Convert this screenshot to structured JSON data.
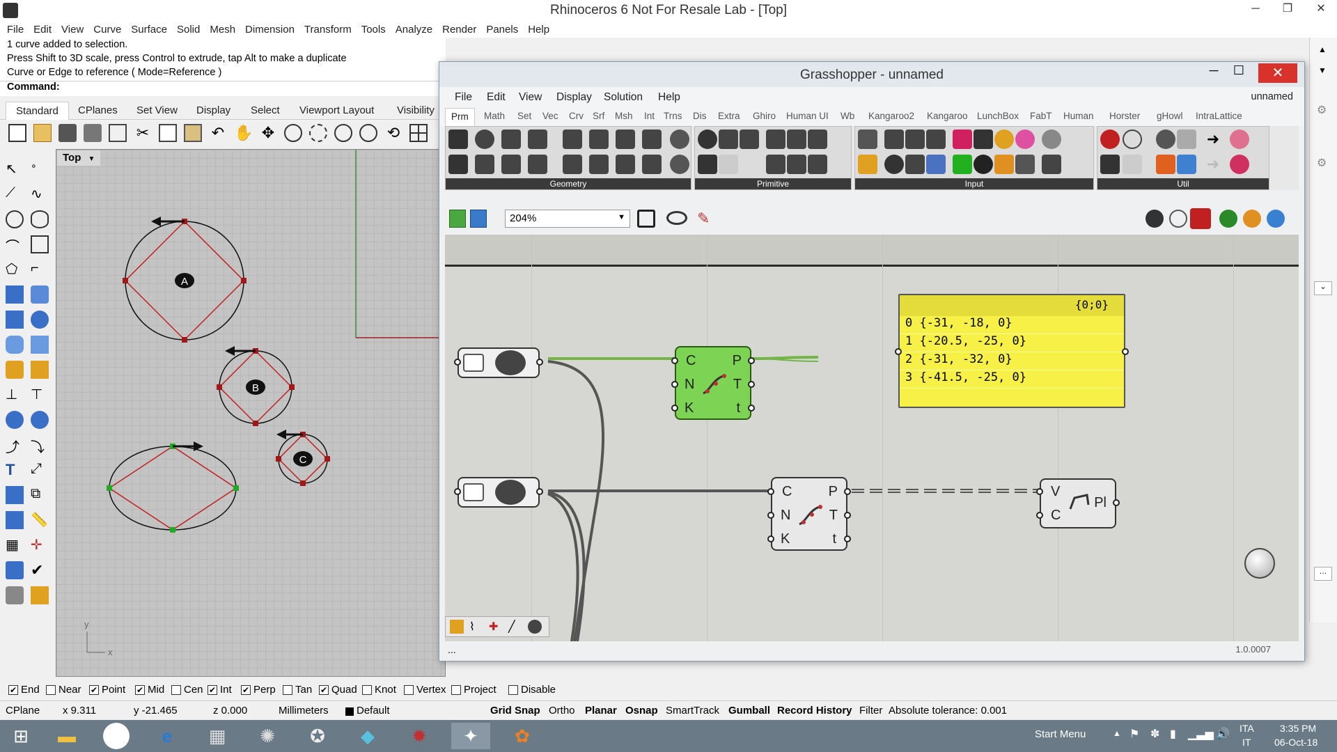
{
  "rhino": {
    "title": "Rhinoceros 6 Not For Resale Lab - [Top]",
    "menu": [
      "File",
      "Edit",
      "View",
      "Curve",
      "Surface",
      "Solid",
      "Mesh",
      "Dimension",
      "Transform",
      "Tools",
      "Analyze",
      "Render",
      "Panels",
      "Help"
    ],
    "history": [
      "1 curve added to selection.",
      "Press Shift to 3D scale, press Control to extrude, tap Alt to make a duplicate",
      "Curve or Edge to reference ( Mode=Reference )"
    ],
    "command_label": "Command:",
    "toolbar_tabs": [
      "Standard",
      "CPlanes",
      "Set View",
      "Display",
      "Select",
      "Viewport Layout",
      "Visibility"
    ],
    "viewport_name": "Top",
    "viewport_labels": {
      "a": "A",
      "b": "B",
      "c": "C",
      "axis_y": "y",
      "axis_x": "x"
    }
  },
  "osnap": [
    {
      "label": "End",
      "checked": true
    },
    {
      "label": "Near",
      "checked": false
    },
    {
      "label": "Point",
      "checked": true
    },
    {
      "label": "Mid",
      "checked": true
    },
    {
      "label": "Cen",
      "checked": false
    },
    {
      "label": "Int",
      "checked": true
    },
    {
      "label": "Perp",
      "checked": true
    },
    {
      "label": "Tan",
      "checked": false
    },
    {
      "label": "Quad",
      "checked": true
    },
    {
      "label": "Knot",
      "checked": false
    },
    {
      "label": "Vertex",
      "checked": false
    },
    {
      "label": "Project",
      "checked": false
    },
    {
      "label": "Disable",
      "checked": false
    }
  ],
  "status": {
    "cplane": "CPlane",
    "x": "x 9.311",
    "y": "y -21.465",
    "z": "z 0.000",
    "units": "Millimeters",
    "layer": "Default",
    "grid_snap": "Grid Snap",
    "ortho": "Ortho",
    "planar": "Planar",
    "osnap": "Osnap",
    "smarttrack": "SmartTrack",
    "gumball": "Gumball",
    "record_history": "Record History",
    "filter": "Filter",
    "tolerance": "Absolute tolerance: 0.001"
  },
  "taskbar": {
    "start_menu": "Start Menu",
    "lang1": "ITA",
    "lang2": "IT",
    "time": "3:35 PM",
    "date": "06-Oct-18"
  },
  "gh": {
    "title": "Grasshopper - unnamed",
    "menu": [
      "File",
      "Edit",
      "View",
      "Display",
      "Solution",
      "Help"
    ],
    "doc_name": "unnamed",
    "tabs": [
      "Prm",
      "Math",
      "Set",
      "Vec",
      "Crv",
      "Srf",
      "Msh",
      "Int",
      "Trns",
      "Dis",
      "Extra",
      "Ghiro",
      "Human UI",
      "Wb",
      "Kangaroo2",
      "Kangaroo",
      "LunchBox",
      "FabT",
      "Human",
      "Horster",
      "gHowl",
      "IntraLattice"
    ],
    "groups": {
      "geometry": "Geometry",
      "primitive": "Primitive",
      "input": "Input",
      "util": "Util"
    },
    "zoom": "204%",
    "panel_header": "{0;0}",
    "panel_rows": [
      {
        "i": "0",
        "v": "{-31, -18, 0}"
      },
      {
        "i": "1",
        "v": "{-20.5, -25, 0}"
      },
      {
        "i": "2",
        "v": "{-31, -32, 0}"
      },
      {
        "i": "3",
        "v": "{-41.5, -25, 0}"
      }
    ],
    "divide": {
      "c": "C",
      "n": "N",
      "k": "K",
      "p": "P",
      "t": "T",
      "tl": "t"
    },
    "pl": {
      "v": "V",
      "c": "C",
      "out": "Pl"
    },
    "version": "1.0.0007",
    "status_left": "..."
  }
}
